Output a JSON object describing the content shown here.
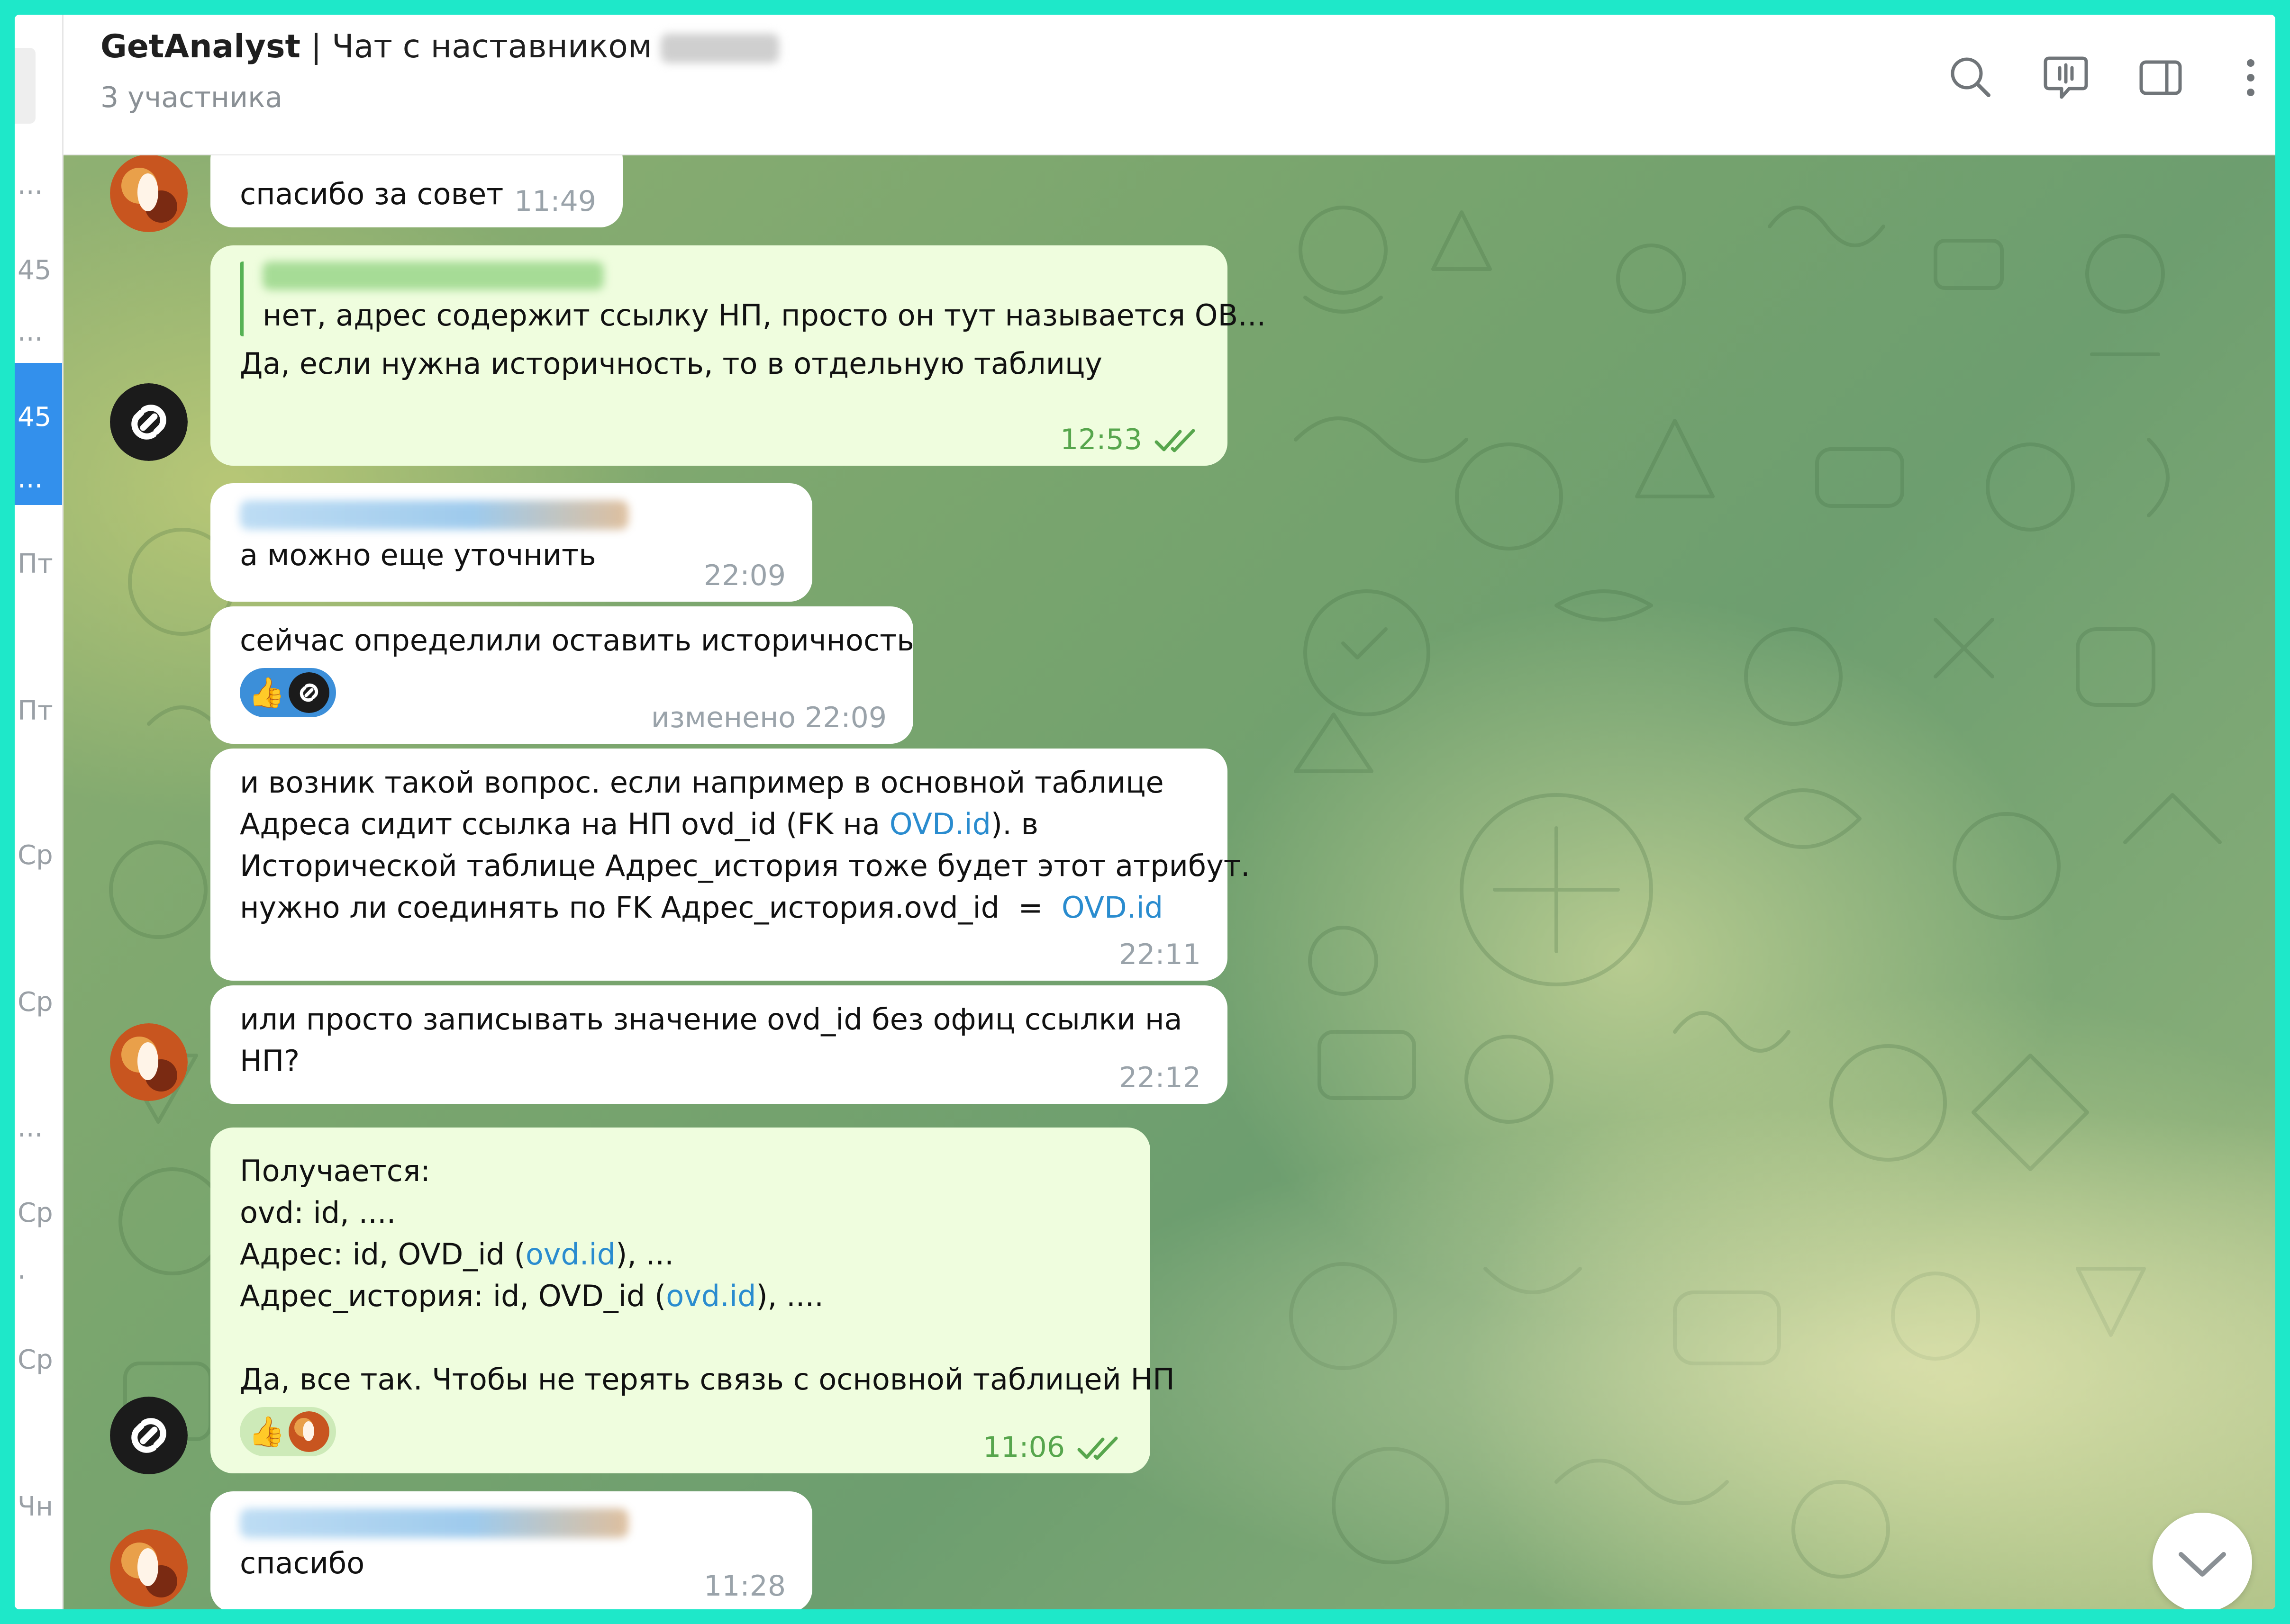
{
  "header": {
    "title_name": "GetAnalyst",
    "title_text": " | Чат с наставником",
    "subtitle": "3 участника",
    "icons": [
      "search-icon",
      "voice-chat-icon",
      "sidebar-toggle-icon",
      "more-vertical-icon"
    ]
  },
  "left_strip": {
    "fragments": [
      "...",
      "45",
      "...",
      "45",
      "...",
      "Пт",
      "Пт",
      "Ср",
      "Ср",
      "...",
      "Ср",
      ".",
      "Ср",
      "Чн"
    ]
  },
  "messages": [
    {
      "lines": [
        "спасибо за совет"
      ],
      "time": "11:49"
    },
    {
      "reply_text": "нет, адрес содержит ссылку НП, просто он тут называется ОВ...",
      "lines": [
        "Да, если нужна историчность, то в отдельную таблицу"
      ],
      "time": "12:53"
    },
    {
      "lines": [
        "а можно еще уточнить"
      ],
      "time": "22:09"
    },
    {
      "lines": [
        "сейчас определили оставить историчность"
      ],
      "time": "изменено 22:09",
      "reaction": "👍"
    },
    {
      "lines_1": "и возник такой вопрос. если например в основной таблице",
      "lines_2a": "Адреса сидит ссылка на НП ovd_id (FK на ",
      "link_1": "OVD.id",
      "lines_2b": "). в",
      "lines_3": "Исторической таблице Адрес_история тоже будет этот атрибут.",
      "lines_4a": "нужно ли соединять по FK Адрес_история.ovd_id  =  ",
      "link_2": "OVD.id",
      "time": "22:11"
    },
    {
      "lines": [
        "или просто записывать значение ovd_id без офиц ссылки на",
        "НП?"
      ],
      "time": "22:12"
    },
    {
      "l1": "Получается:",
      "l2": "ovd: id, ....",
      "l3a": "Адрес: id, OVD_id (",
      "l3link": "ovd.id",
      "l3b": "), ...",
      "l4a": "Адрес_история: id, OVD_id (",
      "l4link": "ovd.id",
      "l4b": "), ....",
      "l5": "Да, все так. Чтобы не терять связь с основной таблицей НП",
      "time": "11:06",
      "reaction": "👍"
    },
    {
      "lines": [
        "спасибо"
      ],
      "time": "11:28"
    }
  ],
  "colors": {
    "frame": "#1ee8c9",
    "accent": "#3390ec",
    "incoming_bubble": "#ffffff",
    "outgoing_bubble": "#effdde",
    "outgoing_time": "#57a64d",
    "link": "#2a8ccf"
  }
}
